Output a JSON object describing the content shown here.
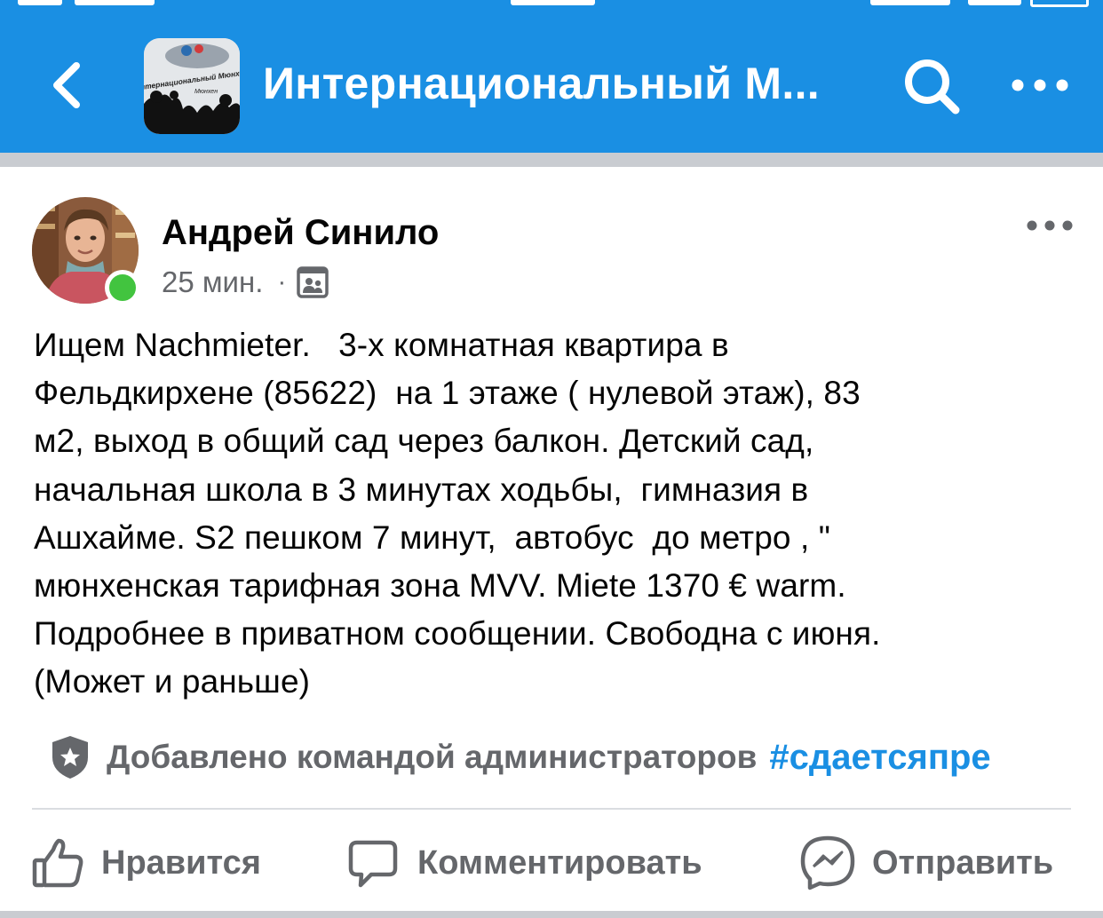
{
  "header": {
    "group_title": "Интернациональный  М...",
    "thumbnail_caption": "Интернациональный Мюнхен",
    "thumbnail_subcaption": "Мюнхен",
    "colors": {
      "bar": "#1a8fe3",
      "icon": "#ffffff"
    },
    "icons": {
      "back": "chevron-left-icon",
      "search": "search-icon",
      "more": "more-horizontal-icon"
    }
  },
  "post": {
    "author": "Андрей Синило",
    "time": "25 мин.",
    "audience_icon": "group-audience-icon",
    "online": true,
    "body": "Ищем Nachmieter.   3-х комнатная квартира в\nФельдкирхене (85622)  на 1 этаже ( нулевой этаж), 83\nм2, выход в общий сад через балкон. Детский сад,\nначальная школа в 3 минутах ходьбы,  гимназия в\nАшхайме. S2 пешком 7 минут,  автобус  до метро , \"\nмюнхенская тарифная зона MVV. Miete 1370 € warm.\nПодробнее в приватном сообщении. Свободна с июня.\n(Может и раньше)",
    "admin_note": "Добавлено командой администраторов",
    "hashtag": "#сдаетсяпре"
  },
  "actions": {
    "like": "Нравится",
    "comment": "Комментировать",
    "share": "Отправить"
  },
  "colors": {
    "text_primary": "#050505",
    "text_secondary": "#65676b",
    "link": "#1a8fe3",
    "online": "#42c43f"
  }
}
